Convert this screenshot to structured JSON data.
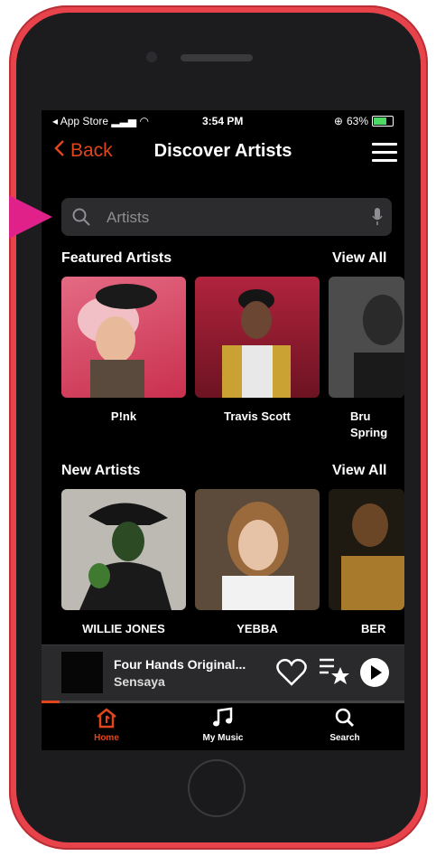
{
  "colors": {
    "accent": "#e0451b",
    "phone": "#e8434b",
    "pointer": "#e0218a"
  },
  "status_bar": {
    "carrier": "◂ App Store",
    "time": "3:54 PM",
    "battery": "63%",
    "battery_level": 0.63
  },
  "nav": {
    "back_label": "Back",
    "title": "Discover Artists"
  },
  "search": {
    "placeholder": "Artists"
  },
  "featured": {
    "title": "Featured Artists",
    "view_all": "View All",
    "artists": [
      {
        "name": "P!nk"
      },
      {
        "name": "Travis Scott"
      },
      {
        "name": "Bru Spring"
      }
    ]
  },
  "new_artists": {
    "title": "New Artists",
    "view_all": "View All",
    "artists": [
      {
        "name": "WILLIE JONES"
      },
      {
        "name": "YEBBA"
      },
      {
        "name": "BER"
      }
    ]
  },
  "now_playing": {
    "title": "Four Hands Original...",
    "artist": "Sensaya",
    "progress": 0.05
  },
  "tabs": [
    {
      "label": "Home",
      "icon": "home-icon",
      "active": true
    },
    {
      "label": "My Music",
      "icon": "music-note-icon",
      "active": false
    },
    {
      "label": "Search",
      "icon": "search-icon",
      "active": false
    }
  ]
}
